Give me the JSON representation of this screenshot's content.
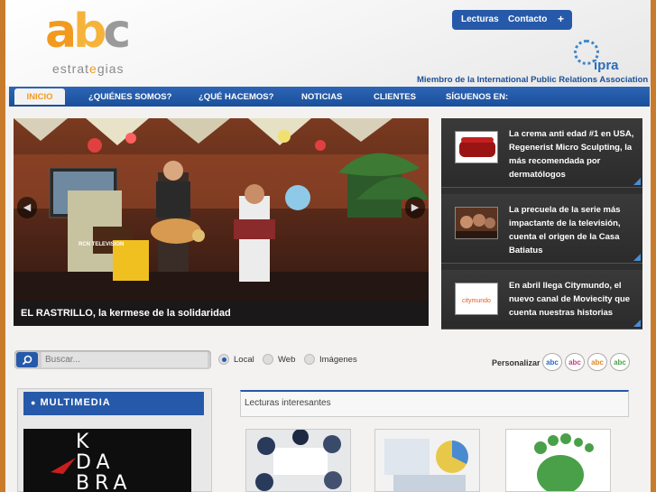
{
  "header": {
    "logo_text": {
      "a": "a",
      "b": "b",
      "c": "c"
    },
    "logo_sub": {
      "pre": "estrat",
      "mid": "e",
      "post": "gias"
    },
    "toplinks": {
      "lecturas": "Lecturas",
      "contacto": "Contacto",
      "plus": "+"
    },
    "ipra_text": "ipra",
    "member": "Miembro de la International Public Relations Association"
  },
  "nav": {
    "items": [
      "INICIO",
      "¿QUIÉNES SOMOS?",
      "¿QUÉ HACEMOS?",
      "NOTICIAS",
      "CLIENTES",
      "SÍGUENOS EN:"
    ]
  },
  "hero": {
    "caption": "EL RASTRILLO, la kermese de la solidaridad",
    "prev": "◀",
    "next": "▶",
    "sign_text": "RCN TELEVISION"
  },
  "news": [
    {
      "text": "La crema anti edad #1 en USA, Regenerist Micro Sculpting, la más recomendada por dermatólogos"
    },
    {
      "text": "La precuela de la serie más impactante de la televisión, cuenta el origen de la Casa Batiatus"
    },
    {
      "text": "En abril llega Citymundo, el nuevo canal de Moviecity que cuenta nuestras historias",
      "thumb_label": "citymundo"
    }
  ],
  "search": {
    "placeholder": "Buscar...",
    "icon": "search-icon",
    "options": [
      "Local",
      "Web",
      "Imágenes"
    ],
    "selected": "Local"
  },
  "personalizar": {
    "label": "Personalizar",
    "badges": [
      "abc",
      "abc",
      "abc",
      "abc"
    ],
    "badge_colors": [
      "#2a6db8",
      "#c0408a",
      "#e08a20",
      "#4aa048"
    ]
  },
  "multimedia": {
    "title": "MULTIMEDIA",
    "image_lines": [
      "K",
      "DA",
      "BRA"
    ]
  },
  "lecturas": {
    "title": "Lecturas interesantes"
  },
  "colors": {
    "brand_blue": "#2659a9",
    "accent_orange": "#f29a1f",
    "frame": "#c87b2a"
  }
}
